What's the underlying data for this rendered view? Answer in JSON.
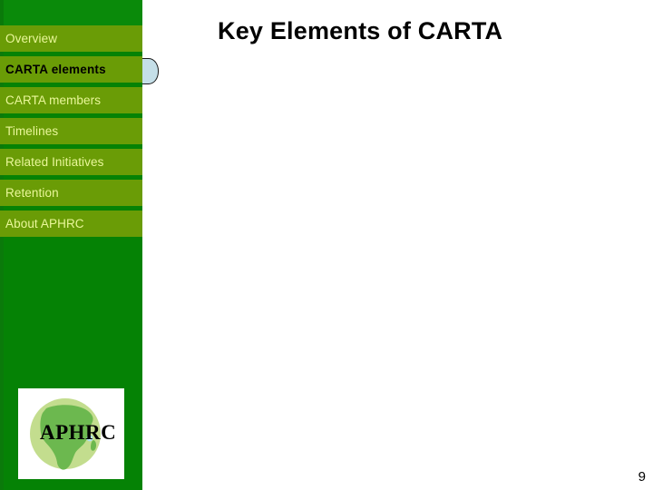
{
  "slide": {
    "title": "Key Elements of CARTA",
    "page_number": "9",
    "background_color": "#ffffff"
  },
  "sidebar": {
    "background_color": "#058205",
    "item_color": "#6a9c06",
    "item_text_color": "#eaf79a",
    "active_item_text_color": "#000000",
    "active_tab_color": "#c5dfe8",
    "items": [
      {
        "label": "Overview",
        "active": false
      },
      {
        "label": "CARTA elements",
        "active": true
      },
      {
        "label": "CARTA members",
        "active": false
      },
      {
        "label": "Timelines",
        "active": false
      },
      {
        "label": "Related Initiatives",
        "active": false
      },
      {
        "label": "Retention",
        "active": false
      },
      {
        "label": "About APHRC",
        "active": false
      }
    ]
  },
  "logo": {
    "name": "aphrc-logo",
    "text": "APHRC",
    "globe_color": "#c3dd8e",
    "africa_color": "#6cb84f",
    "crescent_color": "#000000",
    "background_color": "#ffffff"
  }
}
